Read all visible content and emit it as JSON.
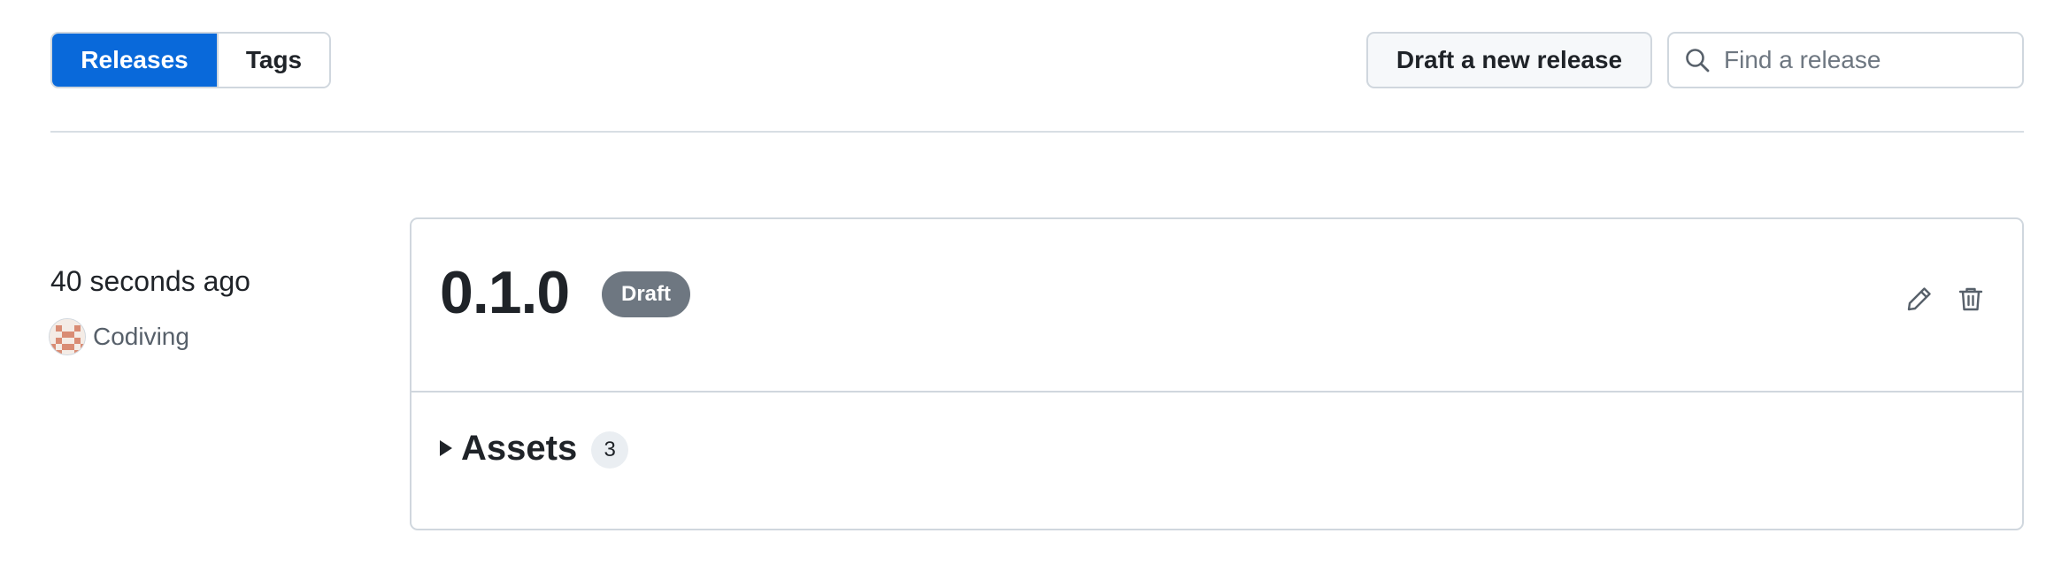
{
  "tabs": {
    "releases_label": "Releases",
    "tags_label": "Tags"
  },
  "toolbar": {
    "draft_button_label": "Draft a new release",
    "search_placeholder": "Find a release",
    "search_value": ""
  },
  "release": {
    "time_ago": "40 seconds ago",
    "author": "Codiving",
    "version": "0.1.0",
    "status_badge": "Draft",
    "assets_label": "Assets",
    "assets_count": "3"
  },
  "icons": {
    "search": "search-icon",
    "edit": "pencil-icon",
    "delete": "trash-icon",
    "expand": "triangle-right-icon",
    "avatar": "identicon-avatar"
  },
  "colors": {
    "accent": "#0969da",
    "badge_bg": "#6e7781",
    "border": "#d0d7de"
  }
}
